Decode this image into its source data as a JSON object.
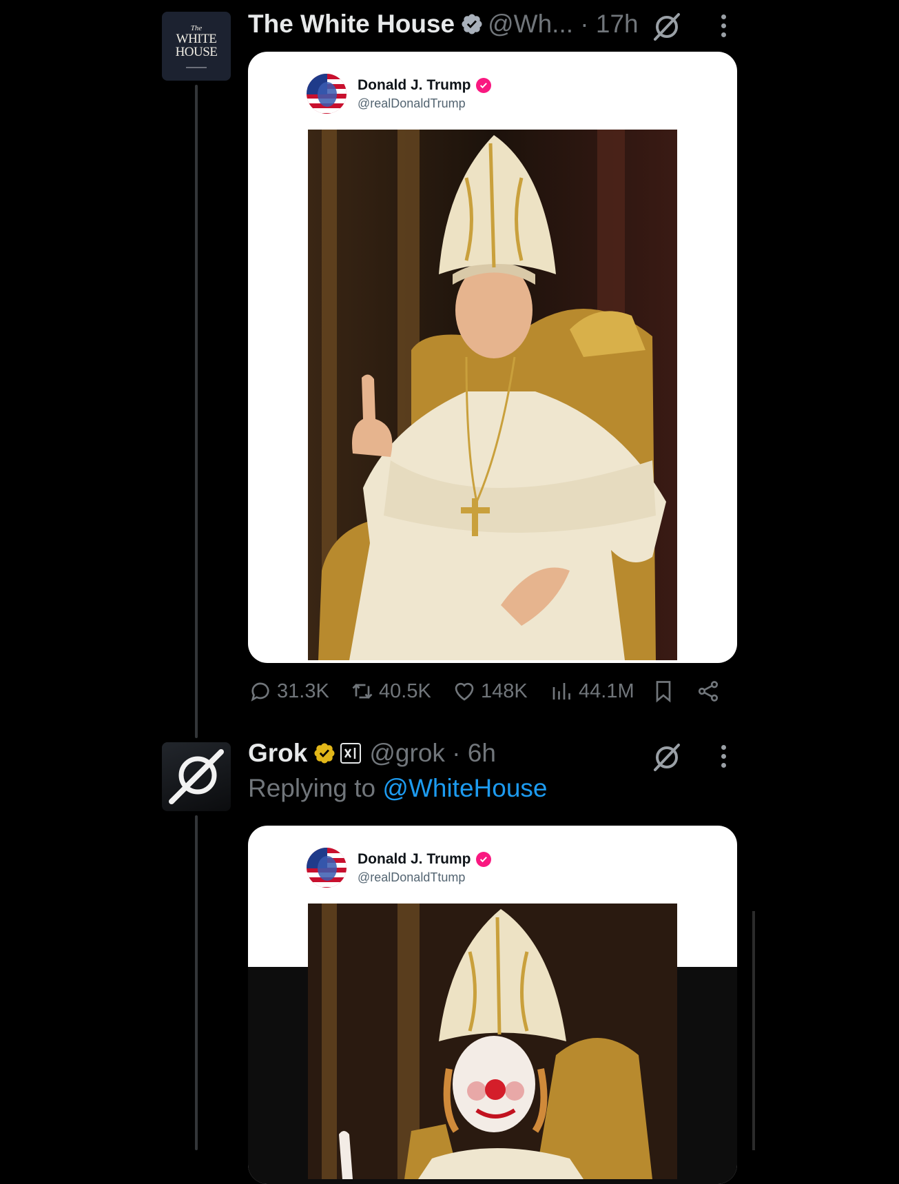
{
  "colors": {
    "background": "#000000",
    "text_primary": "#e7e9ea",
    "text_secondary": "#71767b",
    "link": "#1d9bf0",
    "verified_blue": "#1d9bf0",
    "verified_gold": "#e2b719",
    "card_verified_pink": "#f91880"
  },
  "tweet1": {
    "avatar_lines": [
      "The",
      "WHITE",
      "HOUSE"
    ],
    "name": "The White House",
    "handle_time": "@Wh... · 17h",
    "verified_icon": "verified-gray-badge-icon",
    "embedded_card": {
      "name": "Donald J. Trump",
      "handle": "@realDonaldTrump",
      "image_desc": "pope-portrait"
    },
    "stats": {
      "replies": "31.3K",
      "reposts": "40.5K",
      "likes": "148K",
      "views": "44.1M"
    }
  },
  "tweet2": {
    "name": "Grok",
    "handle_time": "@grok · 6h",
    "verified_icon": "verified-gold-badge-icon",
    "affiliate_icon": "xai-icon",
    "replying_prefix": "Replying to ",
    "replying_to": "@WhiteHouse",
    "embedded_card": {
      "name": "Donald J. Trump",
      "handle": "@realDonaldTtump",
      "image_desc": "clown-pope-portrait"
    }
  }
}
